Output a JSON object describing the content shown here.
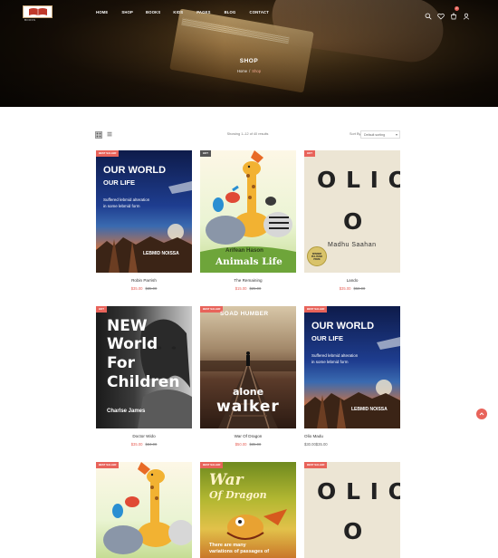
{
  "header": {
    "logo_text": "BOOKS",
    "nav": [
      "HOME",
      "SHOP",
      "BOOKS",
      "KIDS",
      "PAGES",
      "BLOG",
      "CONTACT"
    ],
    "icons": [
      "search-icon",
      "heart-icon",
      "cart-icon",
      "user-icon"
    ],
    "cart_count": "0"
  },
  "hero": {
    "title": "SHOP",
    "breadcrumb": {
      "home": "Home",
      "separator": "/",
      "current": "Shop"
    }
  },
  "toolbar": {
    "result_count": "Showing 1–12 of 40 results",
    "sort_label": "Sort By",
    "sort_value": "Default sorting"
  },
  "products": [
    {
      "badge": "BEST SALLER",
      "title": "Robin Parrish",
      "price_new": "$35.00",
      "price_old": "$35.00",
      "cover": {
        "line1": "OUR WORLD",
        "line2": "OUR LIFE",
        "line3": "Suffered lebmid alteration",
        "line4": "in some lebmid form",
        "author": "LEBMID NOISSA"
      }
    },
    {
      "badge": "HOT",
      "title": "The Remaining",
      "price_new": "$15.00",
      "price_old": "$25.00",
      "cover": {
        "author": "Arifean Hason",
        "title": "Animals Life"
      }
    },
    {
      "badge": "HOT",
      "title": "Lando",
      "price_new": "$35.00",
      "price_old": "$50.00",
      "cover": {
        "line1": "O L I O",
        "line2": "O",
        "author": "Madhu Saahan",
        "seal1": "WINNER",
        "seal2": "PULITZER",
        "seal3": "PRIZE"
      }
    },
    {
      "badge": "HOT",
      "title": "Doctor Wido",
      "price_new": "$35.00",
      "price_old": "$34.00",
      "cover": {
        "line1": "NEW",
        "line2": "World",
        "line3": "For",
        "line4": "Children",
        "author": "Charlse James"
      }
    },
    {
      "badge": "BEST SALLER",
      "title": "War Of Dragon",
      "price_new": "$50.00",
      "price_old": "$35.00",
      "cover": {
        "top": "SOAD HUMBER",
        "line1": "alone",
        "line2": "walker"
      }
    },
    {
      "badge": "BEST SALLER",
      "title": "Olio Madu",
      "price_new": "$30.00$35.00",
      "price_old": "",
      "cover": {
        "line1": "OUR WORLD",
        "line2": "OUR LIFE",
        "line3": "Suffered lebmid alteration",
        "line4": "in some lebmid form",
        "author": "LEBMID NOISSA"
      }
    },
    {
      "badge": "BEST SALLER",
      "title": "",
      "price_new": "",
      "price_old": "",
      "cover": {}
    },
    {
      "badge": "BEST SALLER",
      "title": "",
      "price_new": "",
      "price_old": "",
      "cover": {
        "line1": "War",
        "line2": "Of Dragon",
        "line3": "There are many",
        "line4": "variations of passages of"
      }
    },
    {
      "badge": "BEST SALLER",
      "title": "",
      "price_new": "",
      "price_old": "",
      "cover": {
        "line1": "O L I O",
        "line2": "O"
      }
    }
  ],
  "colors": {
    "accent": "#e8635a",
    "hero_dark": "#1a1008"
  }
}
